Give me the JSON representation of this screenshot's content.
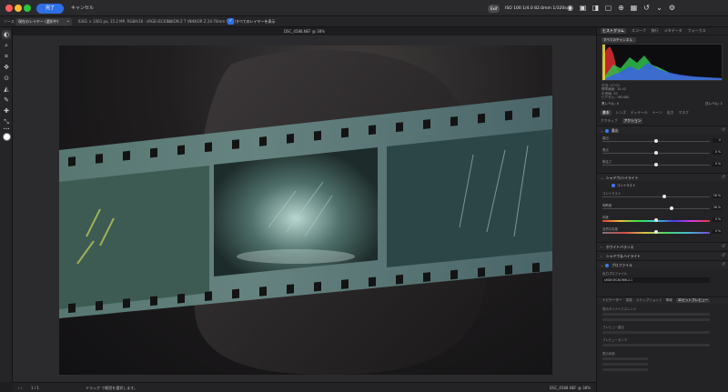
{
  "titlebar": {
    "logo": "a",
    "done_label": "完了",
    "cancel_label": "キャンセル",
    "exif_badge": "Exif",
    "exif_text": "ISO 100 1/4.0 82.0mm 1/320s",
    "icons": [
      "eye-icon",
      "compare-icon",
      "split-view-icon",
      "fit-icon",
      "zoom-icon",
      "grid-icon",
      "history-icon",
      "chevron-down-icon",
      "settings-icon"
    ]
  },
  "ctx": {
    "label": "ソース",
    "select_value": "現在のレイヤー (選択中)",
    "info1": "6361 × 3361 px, 15.2 MP, RGBA/16 · sRGB IEC61…",
    "info2": "NIKON Z 7 (NIKKOR Z 24-70mm f/4 S)",
    "check_label": "すべてのレイヤーを表示"
  },
  "canvas": {
    "title": "DSC_4588.NEF @ 38%"
  },
  "status": {
    "nav": "‹ ›",
    "page": "1 / 1",
    "hint": "ドラッグ で範囲を選択します。",
    "file": "DSC_4588.NEF @ 38%"
  },
  "panel": {
    "tabs": [
      {
        "label": "ヒストグラム",
        "active": true
      },
      {
        "label": "スコープ",
        "active": false
      },
      {
        "label": "移行",
        "active": false
      },
      {
        "label": "メタデータ",
        "active": false
      },
      {
        "label": "フォーカス",
        "active": false
      }
    ],
    "hist_head": "すべてのチャンネル",
    "hist_stats": [
      "平均: 47.03",
      "標準偏差: 33.42",
      "中央値: 35",
      "ピクセル: 780480"
    ],
    "hist_stats2": [
      "",
      "",
      "",
      ""
    ],
    "levels_low": "黒レベル: 0",
    "levels_high": "白レベル: 1",
    "adj_tabs": [
      {
        "label": "基本",
        "active": true
      },
      {
        "label": "レンズ",
        "active": false
      },
      {
        "label": "ディテール",
        "active": false
      },
      {
        "label": "トーン",
        "active": false
      },
      {
        "label": "出力",
        "active": false
      },
      {
        "label": "マスク",
        "active": false
      }
    ],
    "adj_sub": [
      {
        "label": "アクティブ",
        "active": false
      },
      {
        "label": "アクション",
        "active": true
      }
    ],
    "sections": {
      "exposure": "露出",
      "shadows": "シャドウ/ハイライト",
      "white_balance": "ホワイトバランス",
      "color_tone": "シャドウ＆ハイライト",
      "profile": "プロファイル"
    },
    "exposure_sliders": [
      {
        "label": "露出",
        "value": "0",
        "pct": 0.5
      },
      {
        "label": "黒点",
        "value": "0 %",
        "pct": 0.5
      },
      {
        "label": "明るさ",
        "value": "0 %",
        "pct": 0.5
      }
    ],
    "sub_row": "コントラスト",
    "contrast_sliders": [
      {
        "label": "コントラスト",
        "value": "16 %",
        "pct": 0.58,
        "kind": "plain"
      },
      {
        "label": "明瞭度",
        "value": "28 %",
        "pct": 0.64,
        "kind": "plain"
      },
      {
        "label": "彩度",
        "value": "0 %",
        "pct": 0.5,
        "kind": "hue"
      },
      {
        "label": "自然な彩度",
        "value": "0 %",
        "pct": 0.5,
        "kind": "sat"
      }
    ],
    "profile_label": "出力プロファイル",
    "profile_value": "sRGB IEC61966-2.1",
    "bottom_tabs": [
      {
        "label": "ナビゲーター",
        "active": false
      },
      {
        "label": "変換",
        "active": false
      },
      {
        "label": "スナップショット",
        "active": false
      },
      {
        "label": "情報",
        "active": false
      },
      {
        "label": "32ビットプレビュー",
        "active": true
      }
    ],
    "bottom_texts": [
      "表示ダイナミクスレンジ",
      "プレビュー露出",
      "プレビューガンマ",
      "表示状態"
    ]
  }
}
